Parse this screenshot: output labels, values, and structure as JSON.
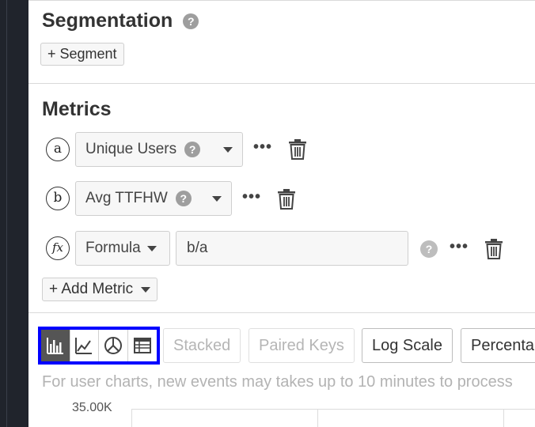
{
  "segmentation": {
    "title": "Segmentation",
    "help": "?",
    "add_segment_label": "+ Segment"
  },
  "metrics": {
    "title": "Metrics",
    "items": [
      {
        "letter": "a",
        "name": "Unique Users",
        "help": "?",
        "more": "•••"
      },
      {
        "letter": "b",
        "name": "Avg TTFHW",
        "help": "?",
        "more": "•••"
      }
    ],
    "formula": {
      "letter": "fx",
      "label": "Formula",
      "value": "b/a",
      "help": "?",
      "more": "•••"
    },
    "add_metric_label": "+ Add Metric"
  },
  "viz_toolbar": {
    "chart_types": [
      "bar-chart",
      "line-chart",
      "pie-chart",
      "table"
    ],
    "active": "bar-chart",
    "options": [
      {
        "label": "Stacked",
        "enabled": false
      },
      {
        "label": "Paired Keys",
        "enabled": false
      },
      {
        "label": "Log Scale",
        "enabled": true
      },
      {
        "label": "Percenta",
        "enabled": true
      }
    ]
  },
  "note": "For user charts, new events may takes up to 10 minutes to process",
  "chart": {
    "y_tick_top": "35.00K"
  },
  "colors": {
    "highlight": "#0000ff",
    "sidebar": "#20242c",
    "active_viz": "#555555"
  }
}
